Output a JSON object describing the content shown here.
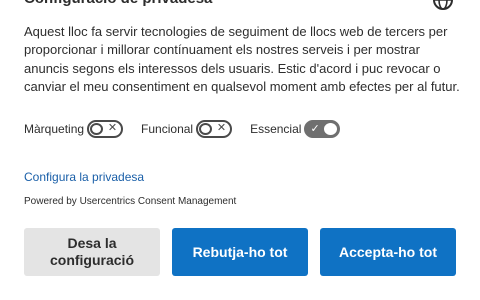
{
  "header": {
    "title": "Configuració de privadesa",
    "globe_icon": "globe-icon"
  },
  "description": "Aquest lloc fa servir tecnologies de seguiment de llocs web de tercers per proporcionar i millorar contínuament els nostres serveis i per mostrar anuncis segons els interessos dels usuaris. Estic d'acord i puc revocar o canviar el meu consentiment en qualsevol moment amb efectes per al futur.",
  "toggles": [
    {
      "label": "Màrqueting",
      "state": "off",
      "symbol": "✕"
    },
    {
      "label": "Funcional",
      "state": "off",
      "symbol": "✕"
    },
    {
      "label": "Essencial",
      "state": "on",
      "symbol": "✓"
    }
  ],
  "links": {
    "privacy_settings": "Configura la privadesa"
  },
  "powered_by": "Powered by Usercentrics Consent Management",
  "buttons": {
    "save": "Desa la configuració",
    "deny": "Rebutja-ho tot",
    "accept": "Accepta-ho tot"
  },
  "colors": {
    "primary": "#0f72c4",
    "secondary_bg": "#e4e4e4",
    "link": "#1a5fa8",
    "text": "#2d2d2d"
  }
}
